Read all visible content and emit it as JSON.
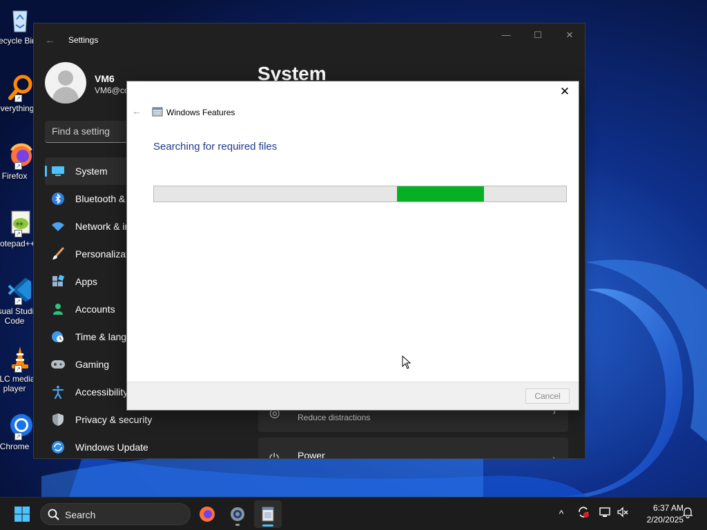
{
  "desktop": {
    "icons": [
      {
        "label": "Recycle Bin"
      },
      {
        "label": "Everything"
      },
      {
        "label": "Firefox"
      },
      {
        "label": "Notepad++"
      },
      {
        "label": "Visual Studio Code"
      },
      {
        "label": "VLC media player"
      },
      {
        "label": "Chrome"
      }
    ]
  },
  "settings": {
    "title": "Settings",
    "user": {
      "name": "VM6",
      "email": "VM6@co"
    },
    "search_placeholder": "Find a setting",
    "nav": [
      {
        "label": "System",
        "icon": "monitor-icon",
        "selected": true
      },
      {
        "label": "Bluetooth & devices",
        "icon": "bluetooth-icon"
      },
      {
        "label": "Network & internet",
        "icon": "wifi-icon"
      },
      {
        "label": "Personalization",
        "icon": "brush-icon"
      },
      {
        "label": "Apps",
        "icon": "apps-icon"
      },
      {
        "label": "Accounts",
        "icon": "accounts-icon"
      },
      {
        "label": "Time & language",
        "icon": "globe-clock-icon"
      },
      {
        "label": "Gaming",
        "icon": "gamepad-icon"
      },
      {
        "label": "Accessibility",
        "icon": "accessibility-icon"
      },
      {
        "label": "Privacy & security",
        "icon": "shield-icon"
      },
      {
        "label": "Windows Update",
        "icon": "update-icon"
      }
    ],
    "page_title": "System",
    "cards": [
      {
        "subtitle": "Reduce distractions",
        "icon": "focus-icon"
      },
      {
        "title": "Power",
        "icon": "power-icon"
      }
    ]
  },
  "dialog": {
    "title": "Windows Features",
    "heading": "Searching for required files",
    "progress": {
      "start": 0.59,
      "end": 0.8
    },
    "cancel_label": "Cancel"
  },
  "taskbar": {
    "search_label": "Search",
    "apps": [
      "firefox-icon",
      "settings-icon",
      "windows-features-icon"
    ],
    "time": "6:37 AM",
    "date": "2/20/2025"
  },
  "colors": {
    "accent": "#4cc2ff",
    "progress_green": "#06b025",
    "dialog_heading": "#1f3a8a"
  }
}
